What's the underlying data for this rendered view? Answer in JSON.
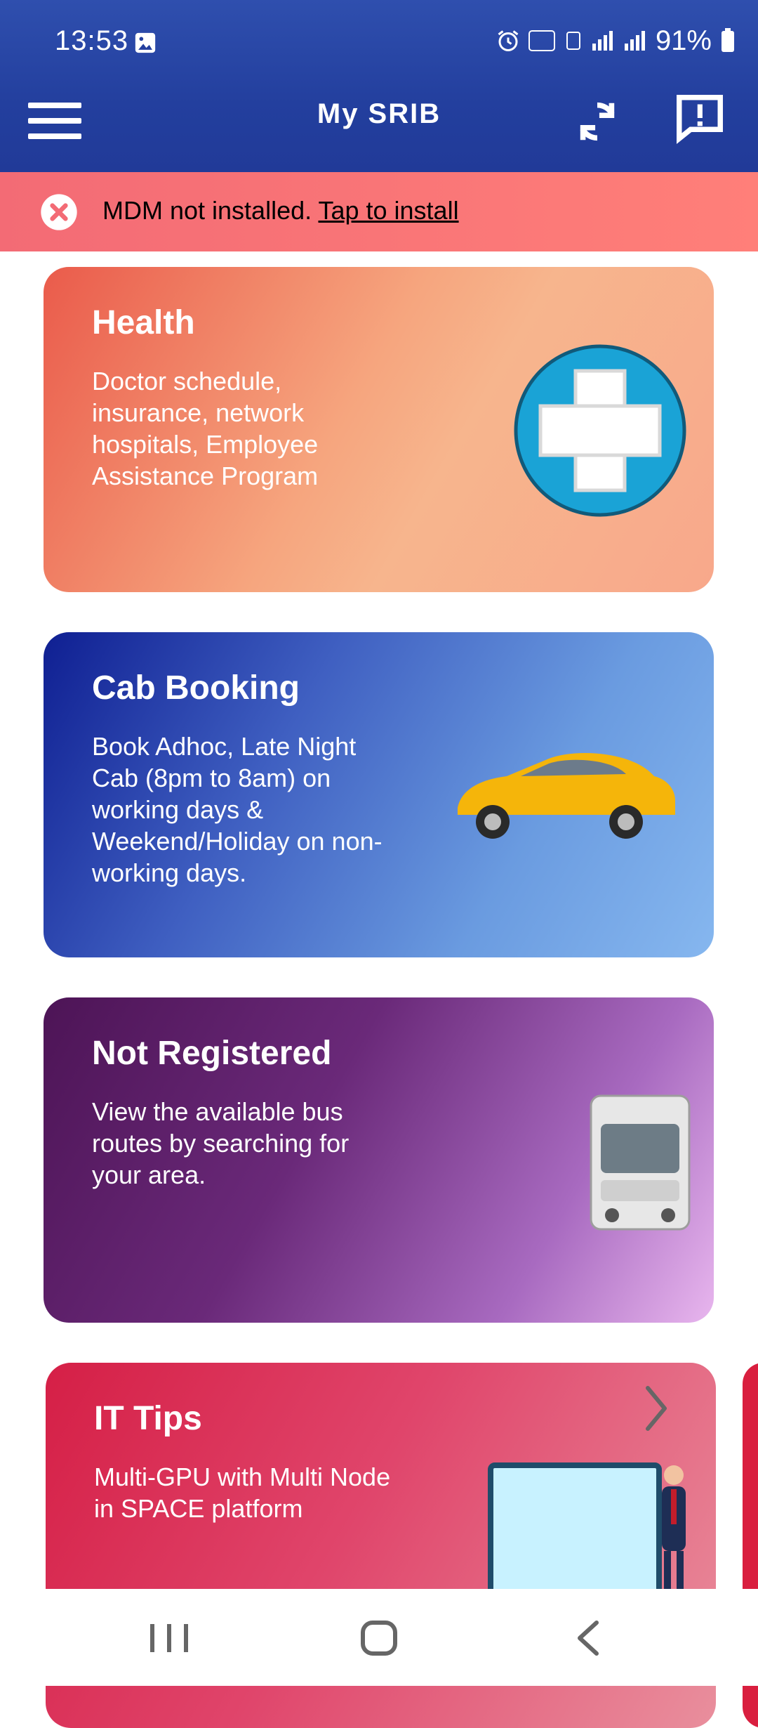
{
  "status_bar": {
    "time": "13:53",
    "battery": "91%",
    "icons": [
      "gallery-icon",
      "alarm-icon",
      "volte-icon",
      "4g-icon",
      "signal-icon",
      "signal-r-icon",
      "battery-icon"
    ]
  },
  "app_bar": {
    "title": "My SRIB",
    "icons": [
      "menu-icon",
      "sync-icon",
      "feedback-icon"
    ]
  },
  "alert": {
    "message": "MDM not installed.",
    "link": "Tap to install",
    "icon": "close-circle-icon"
  },
  "cards": [
    {
      "title": "Health",
      "description": "Doctor schedule, insurance, network hospitals, Employee Assistance Program",
      "icon": "medical-cross-icon"
    },
    {
      "title": "Cab Booking",
      "description": "Book Adhoc, Late Night Cab (8pm to 8am) on working days & Weekend/Holiday on non-working days.",
      "icon": "taxi-car-icon"
    },
    {
      "title": "Not Registered",
      "description": "View the available bus routes by searching for your area.",
      "icon": "bus-icon"
    },
    {
      "title": "IT Tips",
      "description": "Multi-GPU with Multi Node in SPACE platform",
      "icon": "presentation-icon"
    }
  ],
  "nav": {
    "buttons": [
      "recent-apps-icon",
      "home-icon",
      "back-icon"
    ]
  },
  "colors": {
    "app_bar": "#233f9e",
    "alert": "#f36b75",
    "health": "#f6a57e",
    "cab": "#3f5fc1",
    "bus": "#6a2979",
    "tips": "#d51f46"
  }
}
